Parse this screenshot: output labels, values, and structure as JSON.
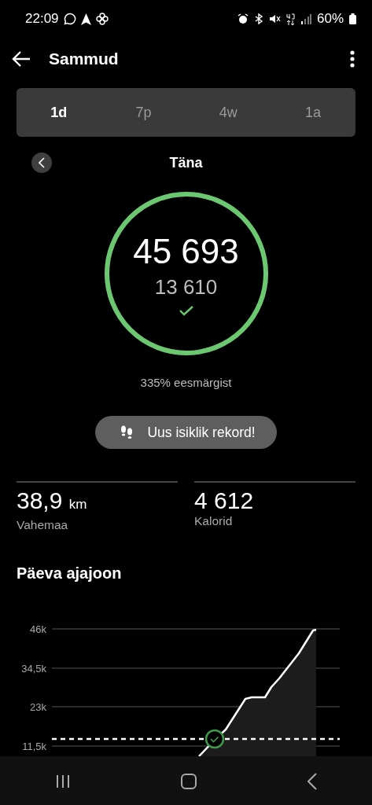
{
  "status_bar": {
    "time": "22:09",
    "battery": "60%"
  },
  "app_bar": {
    "title": "Sammud"
  },
  "tabs": [
    {
      "label": "1d",
      "selected": true
    },
    {
      "label": "7p",
      "selected": false
    },
    {
      "label": "4w",
      "selected": false
    },
    {
      "label": "1a",
      "selected": false
    }
  ],
  "date": {
    "label": "Täna"
  },
  "ring": {
    "level": 1,
    "steps": "45 693",
    "goal": "13 610",
    "goal_met": true
  },
  "goal_percent": "335% eesmärgist",
  "record_badge": {
    "label": "Uus isiklik rekord!"
  },
  "stats": [
    {
      "value": "38,9",
      "unit": "km",
      "label": "Vahemaa"
    },
    {
      "value": "4 612",
      "label": "Kalorid"
    }
  ],
  "chart": {
    "title": "Päeva ajajoon",
    "y_labels": [
      "46k",
      "34,5k",
      "23k",
      "11,5k"
    ]
  }
}
